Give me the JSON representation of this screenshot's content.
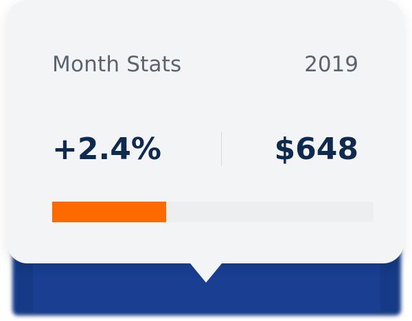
{
  "card": {
    "title": "Month Stats",
    "year": "2019",
    "change": "+2.4%",
    "amount": "$648",
    "progress_fraction": 0.355
  },
  "colors": {
    "accent": "#ff6a00",
    "text_primary": "#0e2a4f",
    "text_secondary": "#5a6470",
    "card_bg": "#f3f4f5",
    "shadow_blue": "#163a86"
  }
}
